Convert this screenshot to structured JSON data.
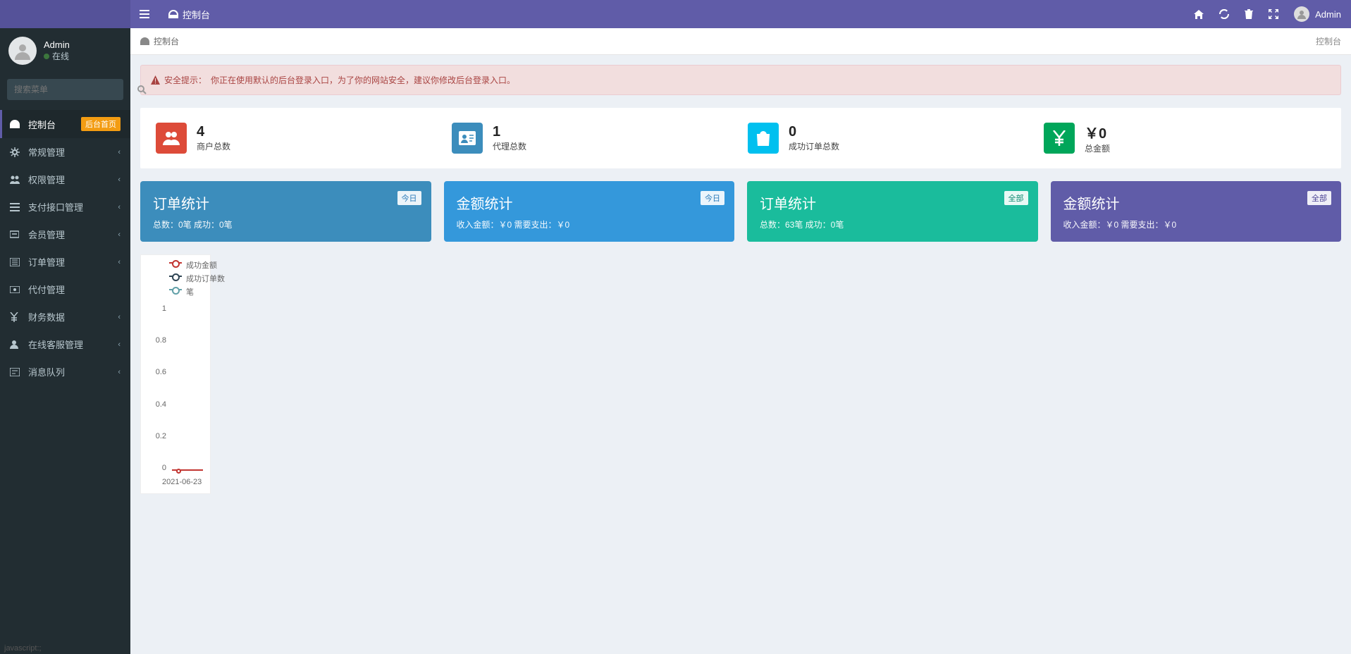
{
  "header": {
    "tab_label": "控制台",
    "user_name": "Admin"
  },
  "sidebar": {
    "user": {
      "name": "Admin",
      "status": "在线"
    },
    "search_placeholder": "搜索菜单",
    "items": [
      {
        "label": "控制台",
        "badge": "后台首页",
        "active": true
      },
      {
        "label": "常规管理"
      },
      {
        "label": "权限管理"
      },
      {
        "label": "支付接口管理"
      },
      {
        "label": "会员管理"
      },
      {
        "label": "订单管理"
      },
      {
        "label": "代付管理"
      },
      {
        "label": "财务数据"
      },
      {
        "label": "在线客服管理"
      },
      {
        "label": "消息队列"
      }
    ]
  },
  "breadcrumb": {
    "left": "控制台",
    "right": "控制台"
  },
  "alert": {
    "prefix": "安全提示：",
    "text": "你正在使用默认的后台登录入口，为了你的网站安全，建议你修改后台登录入口。"
  },
  "stats": [
    {
      "value": "4",
      "label": "商户总数"
    },
    {
      "value": "1",
      "label": "代理总数"
    },
    {
      "value": "0",
      "label": "成功订单总数"
    },
    {
      "value": "￥0",
      "label": "总金额"
    }
  ],
  "summary": [
    {
      "title": "订单统计",
      "detail": "总数：0笔 成功：0笔",
      "tag": "今日"
    },
    {
      "title": "金额统计",
      "detail": "收入金额：￥0 需要支出：￥0",
      "tag": "今日"
    },
    {
      "title": "订单统计",
      "detail": "总数：63笔 成功：0笔",
      "tag": "全部"
    },
    {
      "title": "金额统计",
      "detail": "收入金额：￥0 需要支出：￥0",
      "tag": "全部"
    }
  ],
  "chart_data": {
    "type": "line",
    "series": [
      {
        "name": "成功金额",
        "values": [
          0
        ]
      },
      {
        "name": "成功订单数",
        "values": [
          0
        ]
      },
      {
        "name": "笔",
        "values": [
          0
        ]
      }
    ],
    "categories": [
      "2021-06-23"
    ],
    "xlabel": "",
    "ylabel": "",
    "ylim": [
      0,
      1
    ],
    "yticks": [
      "1",
      "0.8",
      "0.6",
      "0.4",
      "0.2",
      "0"
    ]
  },
  "status": "javascript:;"
}
